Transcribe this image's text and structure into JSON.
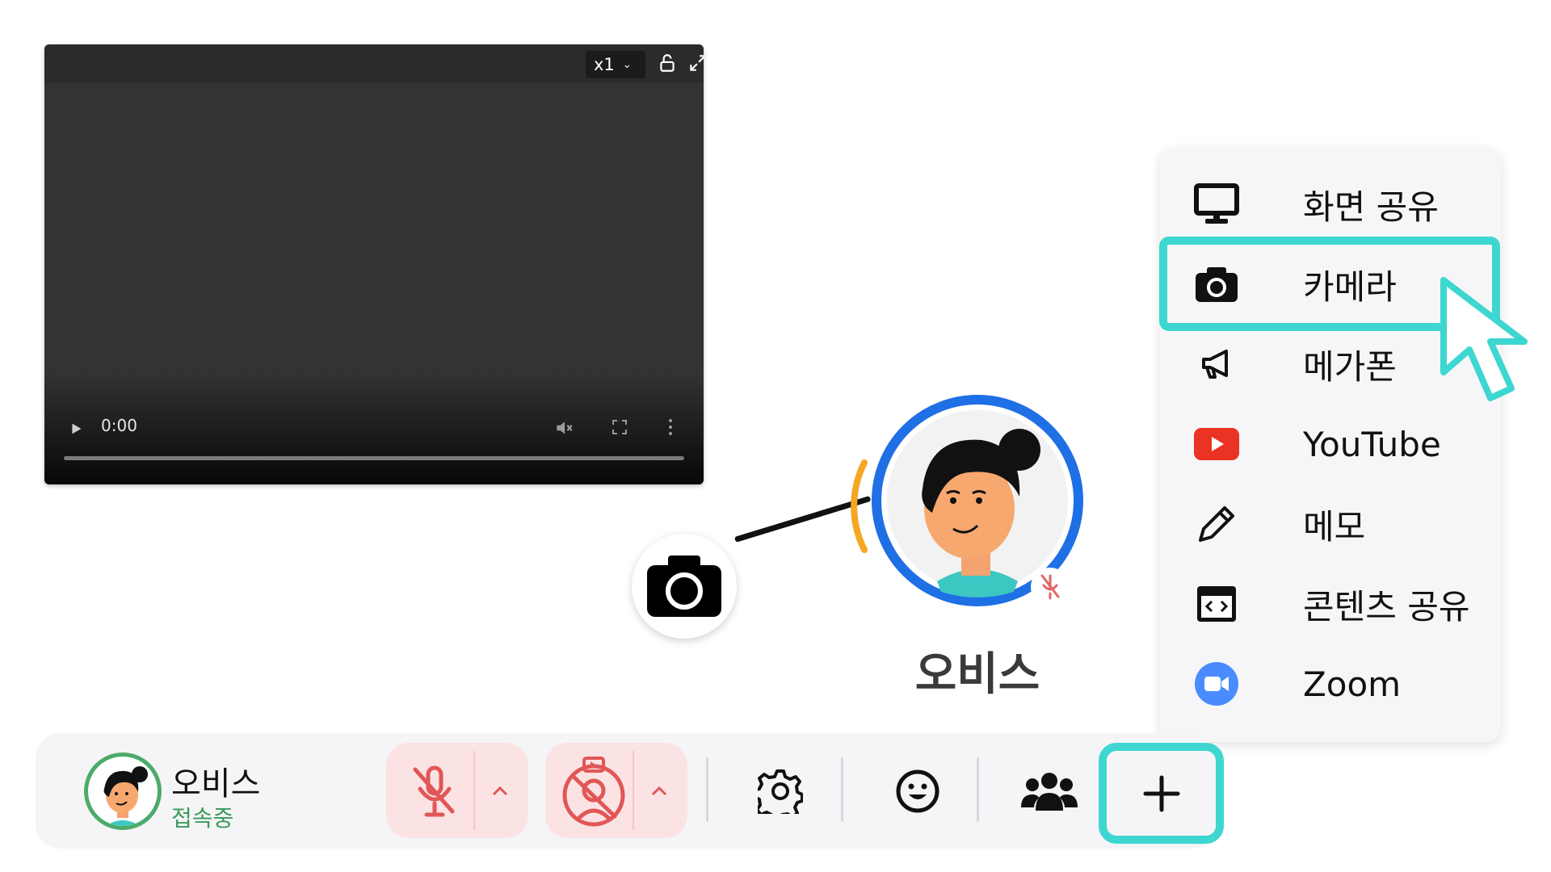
{
  "video": {
    "speed": "x1",
    "time": "0:00"
  },
  "participant": {
    "name": "오비스"
  },
  "menu": {
    "items": [
      {
        "label": "화면 공유",
        "icon": "monitor-icon"
      },
      {
        "label": "카메라",
        "icon": "camera-icon"
      },
      {
        "label": "메가폰",
        "icon": "megaphone-icon"
      },
      {
        "label": "YouTube",
        "icon": "youtube-icon"
      },
      {
        "label": "메모",
        "icon": "pencil-icon"
      },
      {
        "label": "콘텐츠 공유",
        "icon": "embed-icon"
      },
      {
        "label": "Zoom",
        "icon": "zoom-icon"
      }
    ],
    "highlighted": "카메라"
  },
  "toolbar": {
    "user_name": "오비스",
    "user_status": "접속중",
    "accent_color": "#3dd6d0",
    "status_color": "#3b9a5a"
  }
}
